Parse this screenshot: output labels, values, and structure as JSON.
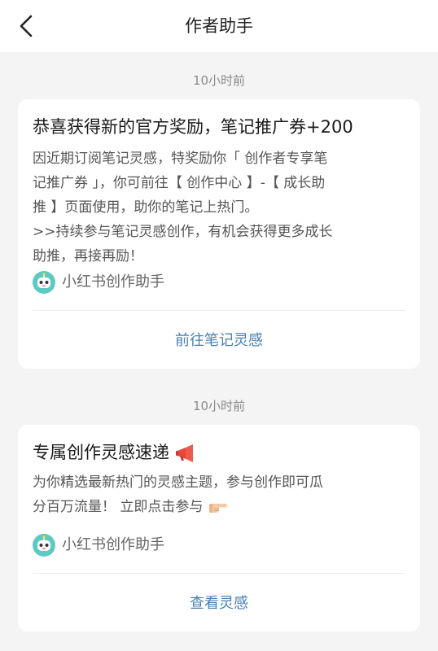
{
  "header": {
    "title": "作者助手"
  },
  "messages": [
    {
      "time": "10小时前",
      "title": "恭喜获得新的官方奖励，笔记推广券+200",
      "body_lines": [
        "因近期订阅笔记灵感，特奖励你「 创作者专享笔",
        "记推广券 」，你可前往【 创作中心 】-【 成长助",
        "推 】页面使用，助你的笔记上热门。",
        ">>持续参与笔记灵感创作，有机会获得更多成长",
        "助推，再接再励！"
      ],
      "sender": "小红书创作助手",
      "action": "前往笔记灵感"
    },
    {
      "time": "10小时前",
      "title": "专属创作灵感速递",
      "body_lines": [
        "为你精选最新热门的灵感主题，参与创作即可瓜",
        "分百万流量！ 立即点击参与"
      ],
      "sender": "小红书创作助手",
      "action": "查看灵感"
    }
  ],
  "icons": {
    "back": "chevron-left-icon",
    "megaphone": "megaphone-icon",
    "pointing": "pointing-right-hand-icon",
    "avatar": "robot-avatar-icon"
  },
  "colors": {
    "background": "#f4f4f5",
    "card": "#ffffff",
    "link": "#4a7fb5",
    "avatar": "#5cc9c2"
  }
}
